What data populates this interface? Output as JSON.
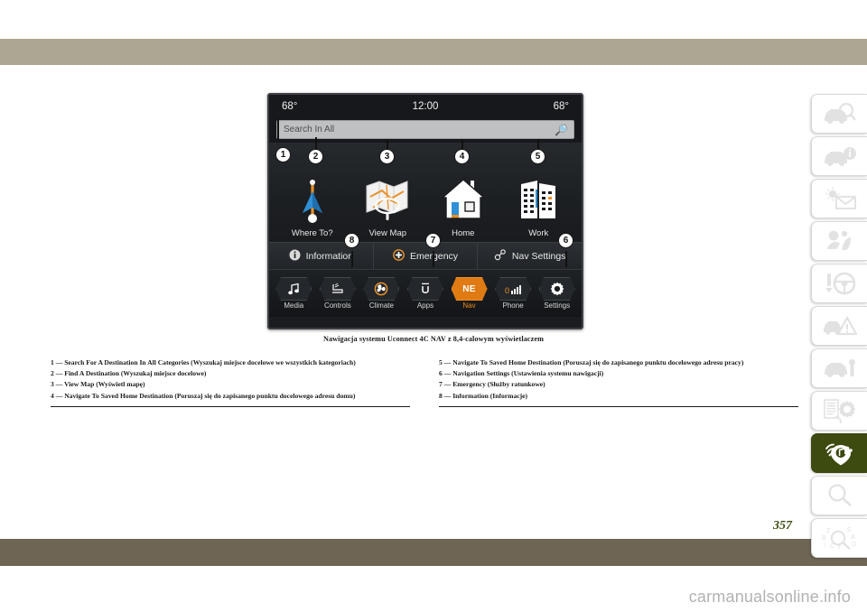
{
  "page": {
    "number": "357",
    "watermark": "carmanualsonline.info",
    "band_top_color": "#aca692",
    "band_bottom_color": "#6e6554",
    "accent_green": "#3d4a10",
    "accent_orange": "#e07a12"
  },
  "caption": "Nawigacja systemu Uconnect 4C NAV z 8,4-calowym wyświetlaczem",
  "screen": {
    "status": {
      "temp_left": "68°",
      "clock": "12:00",
      "temp_right": "68°"
    },
    "search": {
      "placeholder": "Search In All",
      "icon": "search-icon"
    },
    "tiles": [
      {
        "label": "Where To?",
        "icon": "navigation-arrow-icon"
      },
      {
        "label": "View Map",
        "icon": "map-magnifier-icon"
      },
      {
        "label": "Home",
        "icon": "house-icon"
      },
      {
        "label": "Work",
        "icon": "office-building-icon"
      }
    ],
    "actions": [
      {
        "label": "Information",
        "icon": "info-circle-icon"
      },
      {
        "label": "Emergency",
        "icon": "plus-circle-icon"
      },
      {
        "label": "Nav Settings",
        "icon": "nav-settings-icon"
      }
    ],
    "taskbar": [
      {
        "label": "Media",
        "icon": "music-note-icon",
        "active": false,
        "hex_text": ""
      },
      {
        "label": "Controls",
        "icon": "seat-icon",
        "active": false,
        "hex_text": ""
      },
      {
        "label": "Climate",
        "icon": "fan-icon",
        "active": false,
        "hex_text": ""
      },
      {
        "label": "Apps",
        "icon": "apps-u-icon",
        "active": false,
        "hex_text": ""
      },
      {
        "label": "Nav",
        "icon": "compass-ne-icon",
        "active": true,
        "hex_text": "NE"
      },
      {
        "label": "Phone",
        "icon": "signal-bars-icon",
        "active": false,
        "hex_text": ""
      },
      {
        "label": "Settings",
        "icon": "gear-icon",
        "active": false,
        "hex_text": ""
      }
    ]
  },
  "callouts": [
    {
      "n": "1"
    },
    {
      "n": "2"
    },
    {
      "n": "3"
    },
    {
      "n": "4"
    },
    {
      "n": "5"
    },
    {
      "n": "6"
    },
    {
      "n": "7"
    },
    {
      "n": "8"
    }
  ],
  "legend": {
    "left": [
      "1 — Search For A Destination In All Categories (Wyszukaj miejsce docelowe we wszystkich kategoriach)",
      "2 — Find A Destination (Wyszukaj miejsce docelowe)",
      "3 — View Map (Wyświetl mapę)",
      "4 — Navigate To Saved Home Destination (Poruszaj się do zapisanego punktu docelowego adresu domu)"
    ],
    "right": [
      "5 — Navigate To Saved Home Destination (Poruszaj się do zapisanego punktu docelowego adresu pracy)",
      "6 — Navigation Settings (Ustawienia systemu nawigacji)",
      "7 — Emergency (Służby ratunkowe)",
      "8 — Information (Informacje)"
    ]
  },
  "side_tabs": [
    {
      "icon": "car-search-icon",
      "active": false
    },
    {
      "icon": "car-info-icon",
      "active": false
    },
    {
      "icon": "climate-mail-icon",
      "active": false
    },
    {
      "icon": "safety-seat-icon",
      "active": false
    },
    {
      "icon": "steering-wheel-icon",
      "active": false
    },
    {
      "icon": "warning-triangle-icon",
      "active": false
    },
    {
      "icon": "car-wrench-icon",
      "active": false
    },
    {
      "icon": "specs-gear-icon",
      "active": false
    },
    {
      "icon": "multimedia-nav-icon",
      "active": true
    },
    {
      "icon": "magnifier-icon",
      "active": false
    },
    {
      "icon": "index-abc-icon",
      "active": false
    }
  ]
}
